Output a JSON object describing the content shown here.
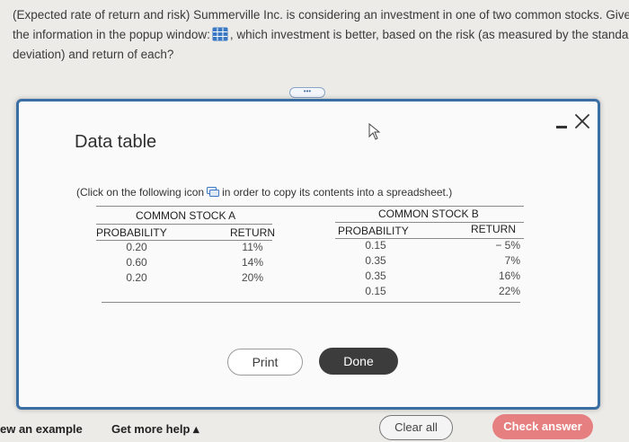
{
  "question": {
    "line1": "(Expected rate of return and risk) Summerville Inc. is considering an investment in one of two common stocks. Given",
    "line2_before": "the information in the popup window:",
    "line2_after": ", which investment is better, based on the risk (as measured by the standard",
    "line3": "deviation) and return of each?"
  },
  "popup": {
    "title": "Data table",
    "instruction_before": "(Click on the following icon",
    "instruction_after": "in order to copy its contents into a spreadsheet.)",
    "stock_a": {
      "heading": "COMMON STOCK A",
      "probability_header": "PROBABILITY",
      "return_header": "RETURN",
      "rows": [
        {
          "probability": "0.20",
          "return": "11%"
        },
        {
          "probability": "0.60",
          "return": "14%"
        },
        {
          "probability": "0.20",
          "return": "20%"
        }
      ]
    },
    "stock_b": {
      "heading": "COMMON STOCK B",
      "probability_header": "PROBABILITY",
      "return_header": "RETURN",
      "rows": [
        {
          "probability": "0.15",
          "return": "− 5%"
        },
        {
          "probability": "0.35",
          "return": "7%"
        },
        {
          "probability": "0.35",
          "return": "16%"
        },
        {
          "probability": "0.15",
          "return": "22%"
        }
      ]
    },
    "print_label": "Print",
    "done_label": "Done"
  },
  "footer": {
    "example_label": "ew an example",
    "help_label": "Get more help ▴",
    "clear_label": "Clear all",
    "check_label": "Check answer"
  },
  "colors": {
    "modal_border": "#3b6fa4",
    "done_button": "#3c3c3c",
    "check_button": "#e67f7f",
    "grid_icon": "#3a78c4"
  },
  "icons": [
    "grid-table-icon",
    "copy-icon",
    "minimize-icon",
    "close-icon",
    "cursor-icon"
  ]
}
